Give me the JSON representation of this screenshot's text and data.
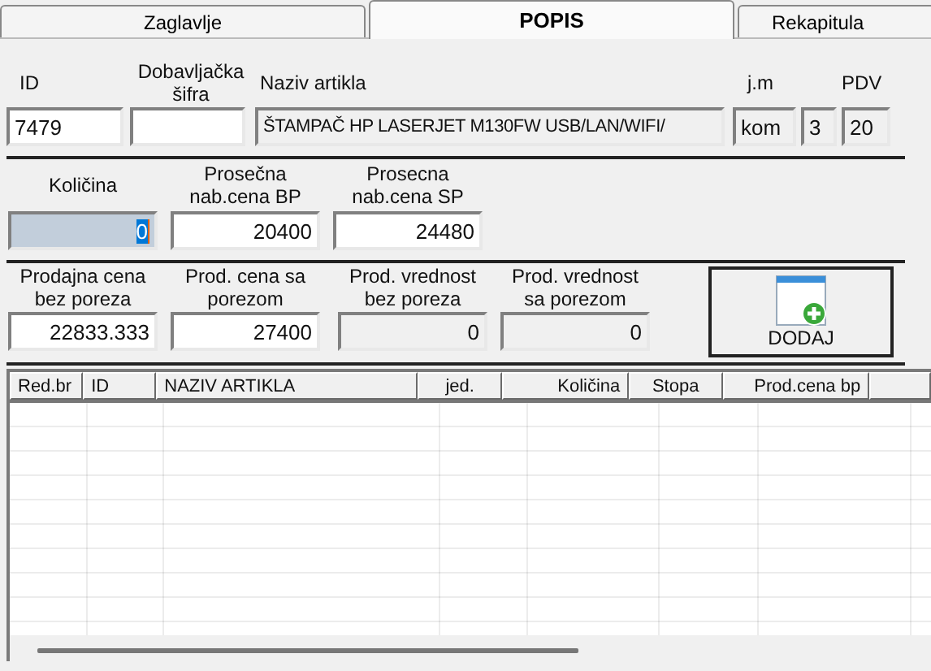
{
  "tabs": [
    {
      "label": "Zaglavlje",
      "selected": false
    },
    {
      "label": "POPIS",
      "selected": true
    },
    {
      "label": "Rekapitula",
      "selected": false
    }
  ],
  "sections": [
    {
      "fields": [
        {
          "label": "ID",
          "value": "7479",
          "readonly": false,
          "focused": false
        },
        {
          "label": "Dobavljačka šifra",
          "readonly": false,
          "focused": false
        },
        {
          "label": "Naziv artikla",
          "value": "ŠTAMPAČ HP LASERJET M130FW USB/LAN/WIFI/",
          "readonly": true,
          "focused": false
        },
        {
          "label": "j.m",
          "value": "kom",
          "readonly": true,
          "focused": false
        },
        {
          "value": "3",
          "readonly": true,
          "focused": false
        },
        {
          "label": "PDV",
          "value": "20",
          "readonly": true,
          "focused": false
        }
      ]
    },
    {
      "fields": [
        {
          "label": "Količina",
          "value": "0",
          "readonly": false,
          "focused": true
        },
        {
          "label": "Prosečna nab.cena BP",
          "value": "20400",
          "readonly": false,
          "focused": false
        },
        {
          "label": "Prosecna nab.cena SP",
          "value": "24480",
          "readonly": false,
          "focused": false
        }
      ]
    },
    {
      "fields": [
        {
          "label": "Prodajna cena bez poreza",
          "value": "22833.333",
          "readonly": false,
          "focused": false
        },
        {
          "label": "Prod. cena sa porezom",
          "value": "27400",
          "readonly": false,
          "focused": false
        },
        {
          "label": "Prod. vrednost bez poreza",
          "value": "0",
          "readonly": true,
          "focused": false
        },
        {
          "label": "Prod. vrednost sa porezom",
          "value": "0",
          "readonly": true,
          "focused": false
        }
      ]
    }
  ],
  "add_button": {
    "label": "DODAJ"
  },
  "table": {
    "columns": [
      "Red.br",
      "ID",
      "NAZIV ARTIKLA",
      "jed.",
      "Količina",
      "Stopa",
      "Prod.cena bp"
    ]
  }
}
